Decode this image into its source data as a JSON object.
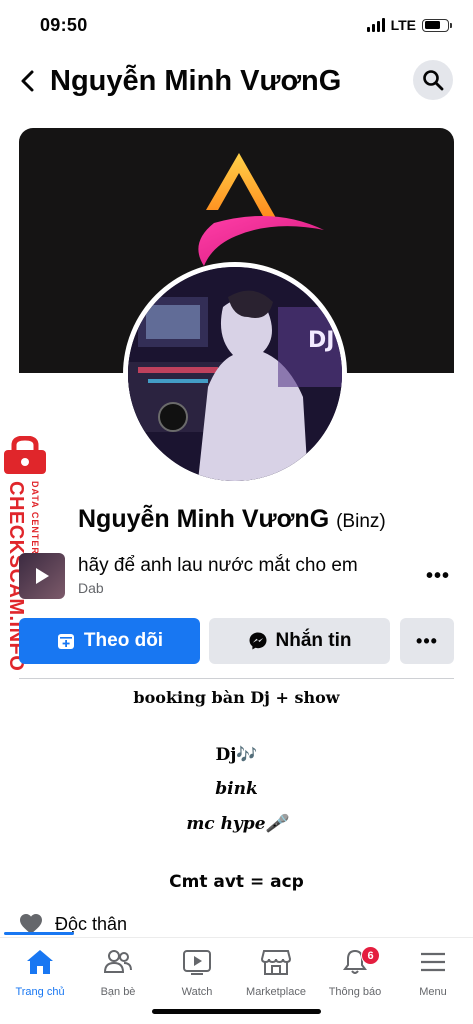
{
  "status_bar": {
    "time": "09:50",
    "network": "LTE"
  },
  "header": {
    "title": "Nguyễn Minh VươnG"
  },
  "watermark": {
    "main": "CHECKSCAM.INFO",
    "sub": "DATA CENTER"
  },
  "profile": {
    "name": "Nguyễn Minh VươnG",
    "alternate_name": "(Binz)"
  },
  "music": {
    "title": "hãy để anh lau nước mắt cho em",
    "artist": "Dab"
  },
  "actions": {
    "follow_label": "Theo dõi",
    "message_label": "Nhắn tin"
  },
  "bio": {
    "line1": "booking bàn Dj + show",
    "line2": "Dj🎶",
    "line3": "bink",
    "line4": "mc hype🎤",
    "line5": "Cmt avt = acp"
  },
  "relationship": {
    "label": "Độc thân"
  },
  "tabbar": {
    "items": [
      {
        "label": "Trang chủ",
        "icon": "home-icon",
        "active": true
      },
      {
        "label": "Bạn bè",
        "icon": "friends-icon"
      },
      {
        "label": "Watch",
        "icon": "watch-icon"
      },
      {
        "label": "Marketplace",
        "icon": "marketplace-icon"
      },
      {
        "label": "Thông báo",
        "icon": "bell-icon",
        "badge": "6"
      },
      {
        "label": "Menu",
        "icon": "menu-icon"
      }
    ]
  },
  "colors": {
    "accent": "#1877f2",
    "badge": "#e41e3f",
    "watermark": "#e0262b"
  }
}
